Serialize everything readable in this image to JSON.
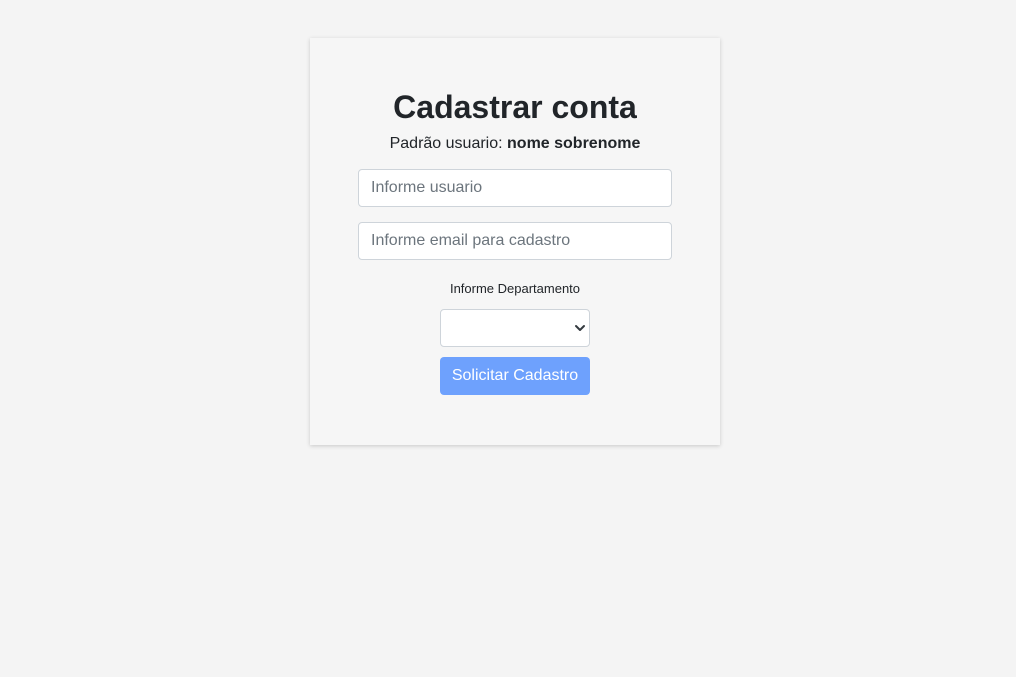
{
  "form": {
    "title": "Cadastrar conta",
    "subtitle_prefix": "Padrão usuario: ",
    "subtitle_pattern": "nome sobrenome",
    "username_placeholder": "Informe usuario",
    "username_value": "",
    "email_placeholder": "Informe email para cadastro",
    "email_value": "",
    "department_label": "Informe Departamento",
    "department_selected": "",
    "submit_label": "Solicitar Cadastro"
  },
  "colors": {
    "page_background": "#f4f4f4",
    "card_background": "#f6f6f6",
    "button_primary": "#6ea1fd",
    "input_border": "#ced4da"
  },
  "icons": {
    "select_arrow": "chevron-down-icon"
  }
}
